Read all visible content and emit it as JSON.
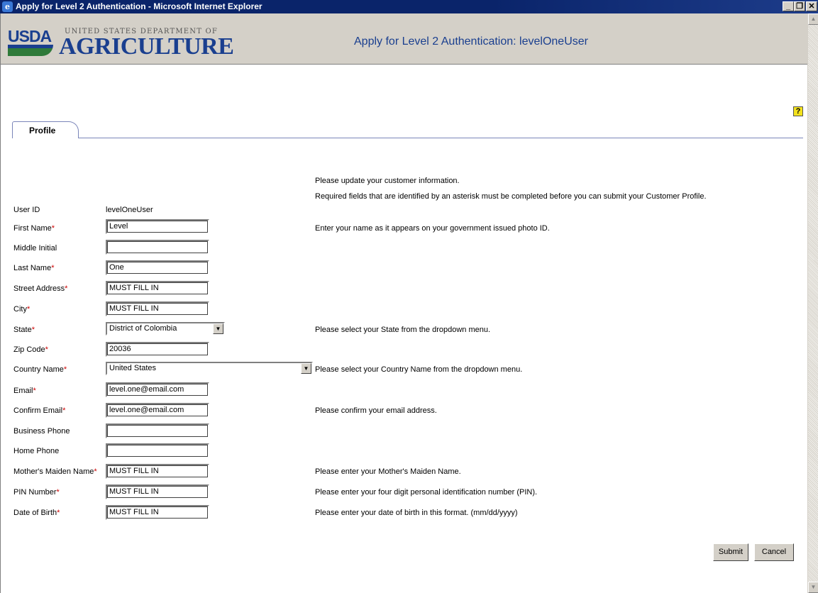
{
  "window": {
    "title": "Apply for Level 2 Authentication - Microsoft Internet Explorer",
    "minimize": "_",
    "maximize": "❐",
    "close": "✕"
  },
  "header": {
    "logo_usda": "USDA",
    "logo_dept": "UNITED STATES DEPARTMENT OF",
    "logo_agri": "AGRICULTURE",
    "title": "Apply for Level 2 Authentication: levelOneUser",
    "help_icon": "?"
  },
  "tabs": [
    {
      "label": "Profile"
    }
  ],
  "instructions": {
    "line1": "Please update your customer information.",
    "line2": "Required fields that are identified by an asterisk must be completed before you can submit your Customer Profile."
  },
  "form": {
    "user_id": {
      "label": "User ID",
      "value": "levelOneUser"
    },
    "first_name": {
      "label": "First Name",
      "value": "Level",
      "required": true,
      "note": "Enter your name as it appears on your government issued photo ID."
    },
    "middle_initial": {
      "label": "Middle Initial",
      "value": ""
    },
    "last_name": {
      "label": "Last Name",
      "value": "One",
      "required": true
    },
    "street_address": {
      "label": "Street Address",
      "value": "MUST FILL IN",
      "required": true
    },
    "city": {
      "label": "City",
      "value": "MUST FILL IN",
      "required": true
    },
    "state": {
      "label": "State",
      "value": "District of Colombia",
      "required": true,
      "note": "Please select your State from the dropdown menu."
    },
    "zip_code": {
      "label": "Zip Code",
      "value": "20036",
      "required": true
    },
    "country": {
      "label": "Country Name",
      "value": "United States",
      "required": true,
      "note": "Please select your Country Name from the dropdown menu."
    },
    "email": {
      "label": "Email",
      "value": "level.one@email.com",
      "required": true
    },
    "confirm_email": {
      "label": "Confirm Email",
      "value": "level.one@email.com",
      "required": true,
      "note": "Please confirm your email address."
    },
    "business_phone": {
      "label": "Business Phone",
      "value": ""
    },
    "home_phone": {
      "label": "Home Phone",
      "value": ""
    },
    "maiden_name": {
      "label": "Mother's Maiden Name",
      "value": "MUST FILL IN",
      "required": true,
      "note": "Please enter your Mother's Maiden Name."
    },
    "pin": {
      "label": "PIN Number",
      "value": "MUST FILL IN",
      "required": true,
      "note": "Please enter your four digit personal identification number (PIN)."
    },
    "dob": {
      "label": "Date of Birth",
      "value": "MUST FILL IN",
      "required": true,
      "note": "Please enter your date of birth in this format. (mm/dd/yyyy)"
    },
    "required_marker": "*"
  },
  "buttons": {
    "submit": "Submit",
    "cancel": "Cancel"
  }
}
